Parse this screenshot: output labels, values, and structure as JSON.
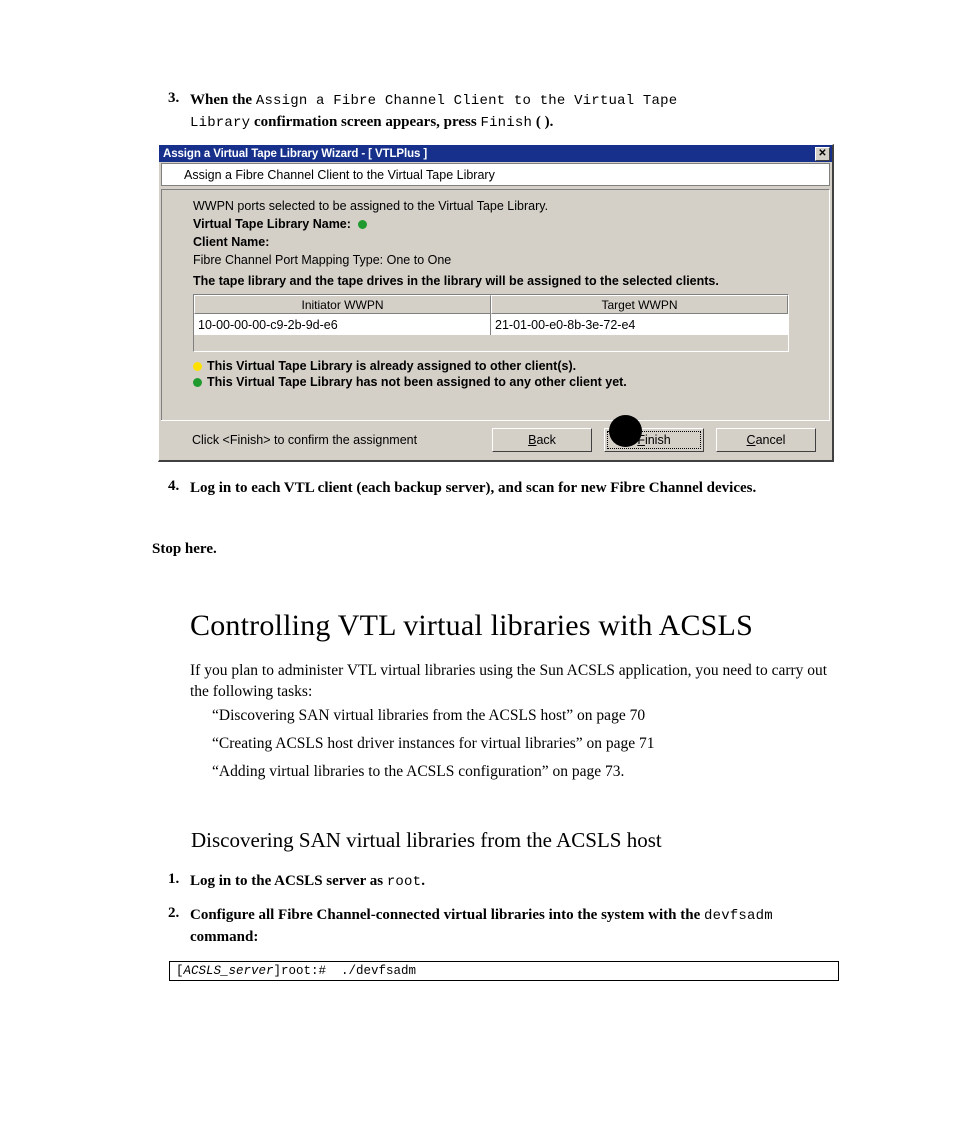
{
  "doc": {
    "step3": {
      "number": "3.",
      "seg1": "When the ",
      "seg2_mono": "Assign a Fibre Channel Client to the Virtual Tape",
      "seg3_mono": "Library",
      "seg4": " confirmation screen appears, press ",
      "seg5_mono": "Finish",
      "seg6": " ( )."
    },
    "step4": {
      "number": "4.",
      "text": "Log in to each VTL client (each backup server), and scan for new Fibre Channel devices."
    },
    "stop_here": "Stop here.",
    "heading1": "Controlling VTL virtual libraries with ACSLS",
    "intro": "If you plan to administer VTL virtual libraries using the Sun ACSLS application, you need to carry out the following tasks:",
    "xrefs": [
      "“Discovering SAN virtual libraries from the ACSLS host” on page 70",
      "“Creating ACSLS host driver instances for virtual libraries” on page 71",
      "“Adding virtual libraries to the ACSLS configuration” on page 73."
    ],
    "heading2": "Discovering SAN virtual libraries from the ACSLS host",
    "step1": {
      "number": "1.",
      "seg1": "Log in to the ACSLS server as ",
      "seg2_mono": "root",
      "seg3": "."
    },
    "step2": {
      "number": "2.",
      "seg1": "Configure all Fibre Channel-connected virtual libraries into the system with the ",
      "seg2_mono": "devfsadm",
      "seg3": " command:"
    },
    "command_box": {
      "prefix": "[",
      "variable": "ACSLS_server",
      "suffix": "]root:#  ./devfsadm"
    }
  },
  "dialog": {
    "title": "Assign a Virtual Tape Library Wizard - [ VTLPlus ]",
    "close_glyph": "✕",
    "subtitle": "Assign a Fibre Channel Client to the Virtual Tape Library",
    "intro_line": "WWPN ports selected to be assigned to the Virtual Tape Library.",
    "fields": [
      {
        "label": "Virtual Tape Library Name:",
        "status_dot": "green"
      },
      {
        "label": "Client Name:",
        "status_dot": "none"
      }
    ],
    "mapping_line": "Fibre Channel Port Mapping Type: One to One",
    "assign_note": "The tape library and the tape drives in the library will be assigned to the selected clients.",
    "table": {
      "headers": [
        "Initiator WWPN",
        "Target WWPN"
      ],
      "rows": [
        [
          "10-00-00-00-c9-2b-9d-e6",
          "21-01-00-e0-8b-3e-72-e4"
        ]
      ]
    },
    "legend": [
      {
        "color": "yellow",
        "text": "This Virtual Tape Library is already assigned to other client(s)."
      },
      {
        "color": "green",
        "text": "This Virtual Tape Library has not been assigned to any other client yet."
      }
    ],
    "footer_hint": "Click <Finish> to confirm the assignment",
    "buttons": [
      {
        "name": "back",
        "pre": "",
        "mnemonic": "B",
        "post": "ack",
        "focused": false
      },
      {
        "name": "finish",
        "pre": "",
        "mnemonic": "F",
        "post": "inish",
        "focused": true
      },
      {
        "name": "cancel",
        "pre": "",
        "mnemonic": "C",
        "post": "ancel",
        "focused": false
      }
    ]
  },
  "colors": {
    "titlebar": "#16308c",
    "dialog_face": "#d4d0c8",
    "green_dot": "#1f9a2f",
    "yellow_dot": "#ffe000",
    "callout": "#000000"
  }
}
